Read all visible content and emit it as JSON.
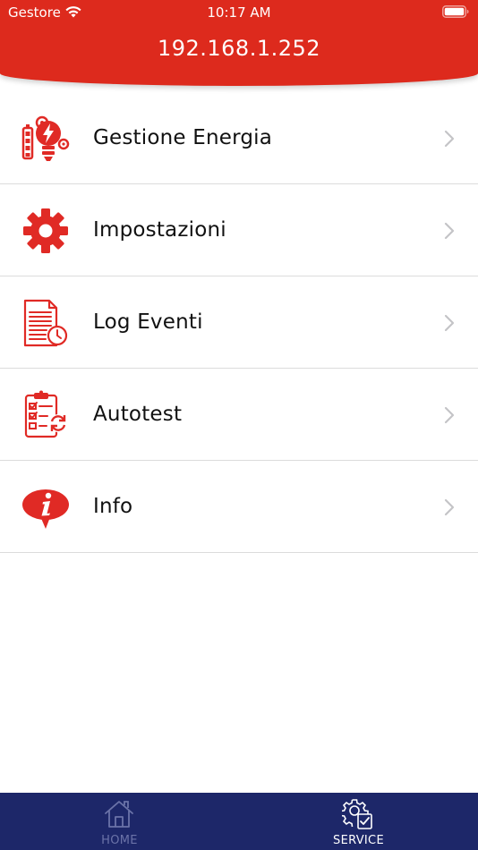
{
  "status_bar": {
    "carrier": "Gestore",
    "time": "10:17 AM"
  },
  "header": {
    "title": "192.168.1.252"
  },
  "menu": {
    "items": [
      {
        "label": "Gestione Energia",
        "icon": "energy-management-icon"
      },
      {
        "label": "Impostazioni",
        "icon": "gear-icon"
      },
      {
        "label": "Log Eventi",
        "icon": "event-log-icon"
      },
      {
        "label": "Autotest",
        "icon": "checklist-icon"
      },
      {
        "label": "Info",
        "icon": "info-icon"
      }
    ]
  },
  "tabbar": {
    "tabs": [
      {
        "label": "HOME",
        "icon": "home-icon",
        "active": false
      },
      {
        "label": "SERVICE",
        "icon": "service-icon",
        "active": true
      }
    ]
  },
  "colors": {
    "header": "#dd2a1d",
    "accent_red": "#e02a25",
    "tabbar": "#1d2769",
    "tab_inactive": "#6b73a8",
    "tab_active": "#ffffff",
    "chevron": "#c4c4c7"
  }
}
